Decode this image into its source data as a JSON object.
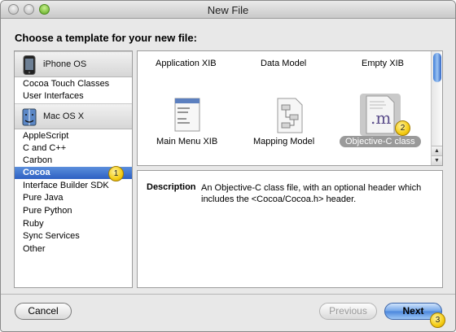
{
  "window": {
    "title": "New File"
  },
  "heading": "Choose a template for your new file:",
  "sidebar": {
    "groups": [
      {
        "label": "iPhone OS",
        "items": [
          "Cocoa Touch Classes",
          "User Interfaces"
        ]
      },
      {
        "label": "Mac OS X",
        "items": [
          "AppleScript",
          "C and C++",
          "Carbon",
          "Cocoa",
          "Interface Builder SDK",
          "Pure Java",
          "Pure Python",
          "Ruby",
          "Sync Services",
          "Other"
        ]
      }
    ],
    "selected_item": "Cocoa"
  },
  "templates": {
    "items": [
      "Application XIB",
      "Data Model",
      "Empty XIB",
      "Main Menu XIB",
      "Mapping Model",
      "Objective-C class"
    ],
    "selected": "Objective-C class",
    "objc_icon_glyph": ".m"
  },
  "description": {
    "label": "Description",
    "text": "An Objective-C class file, with an optional header which includes the <Cocoa/Cocoa.h> header."
  },
  "buttons": {
    "cancel": "Cancel",
    "previous": "Previous",
    "next": "Next"
  },
  "badges": [
    "1",
    "2",
    "3"
  ],
  "colors": {
    "selection": "#2d60c2",
    "badge": "#f4cc14",
    "default_button": "#4a86dc"
  }
}
